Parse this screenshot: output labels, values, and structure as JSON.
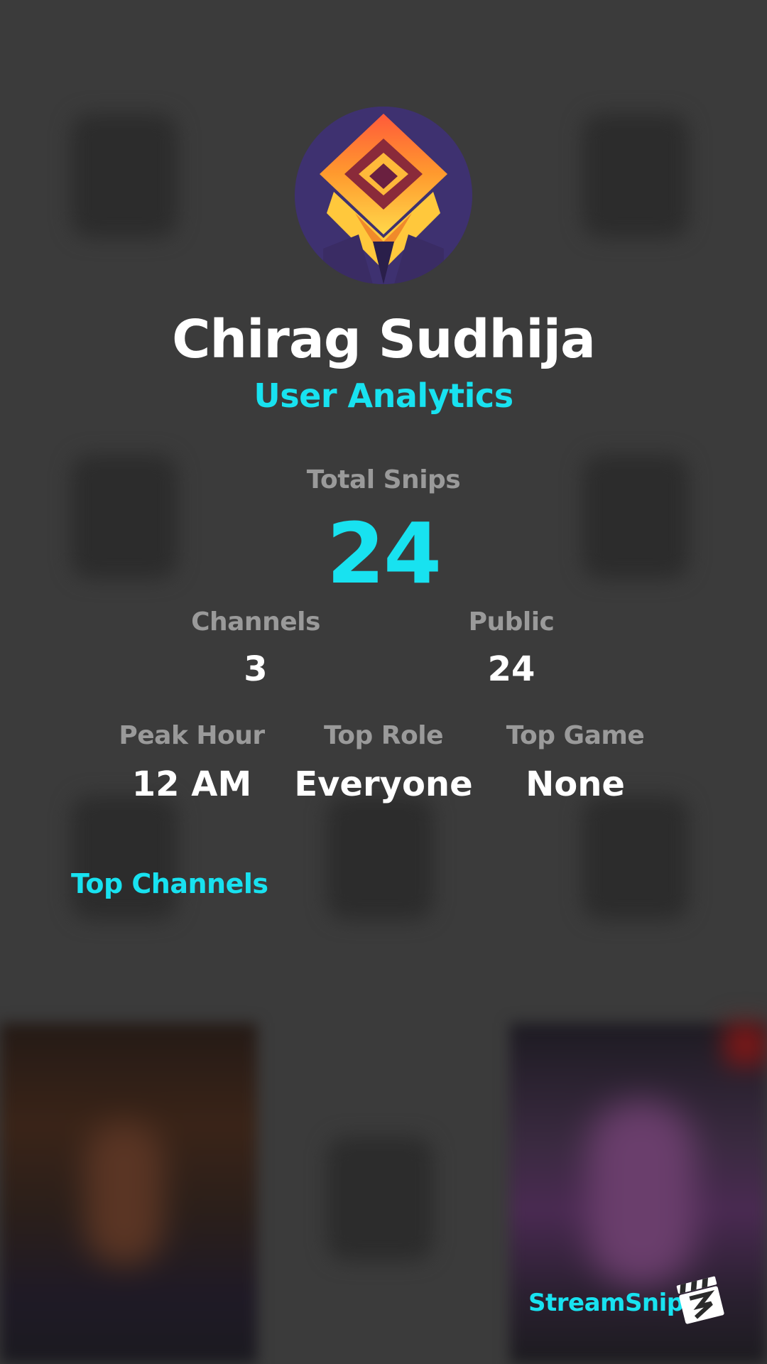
{
  "profile": {
    "name": "Chirag Sudhija",
    "subtitle": "User Analytics"
  },
  "stats": {
    "total_snips_label": "Total Snips",
    "total_snips_value": "24",
    "channels_label": "Channels",
    "channels_value": "3",
    "public_label": "Public",
    "public_value": "24",
    "peak_hour_label": "Peak Hour",
    "peak_hour_value": "12 AM",
    "top_role_label": "Top Role",
    "top_role_value": "Everyone",
    "top_game_label": "Top Game",
    "top_game_value": "None"
  },
  "sections": {
    "top_channels_label": "Top Channels"
  },
  "brand": {
    "name": "StreamSnip",
    "logo_icon": "clapperboard-icon"
  },
  "colors": {
    "accent": "#18e2f0",
    "background": "#3b3b3b",
    "label_gray": "#9a9a9a",
    "text_white": "#ffffff"
  }
}
